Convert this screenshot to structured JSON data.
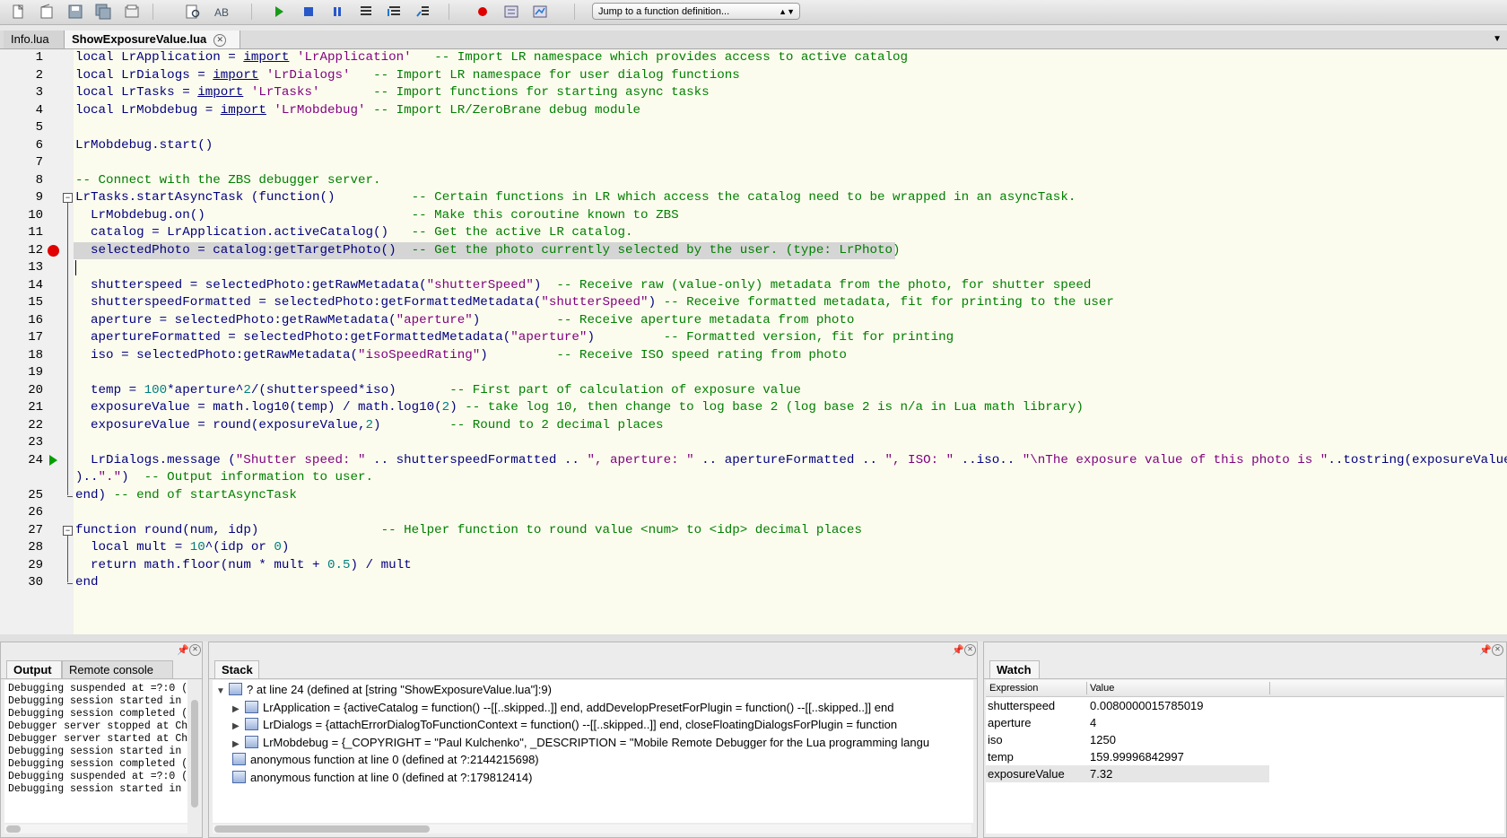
{
  "toolbar": {
    "buttons": [
      "new-file-icon",
      "open-file-icon",
      "save-icon",
      "save-all-icon",
      "project-directory-icon",
      "find-icon",
      "replace-icon",
      "run-icon",
      "stop-icon",
      "break-icon",
      "step-into-icon",
      "step-over-icon",
      "step-out-icon",
      "toggle-breakpoint-icon",
      "stack-window-icon",
      "watch-window-icon"
    ],
    "function_jump": "Jump to a function definition..."
  },
  "tabs": [
    {
      "label": "Info.lua",
      "active": false
    },
    {
      "label": "ShowExposureValue.lua",
      "active": true
    }
  ],
  "editor": {
    "breakpoint_line": 12,
    "current_line": 24,
    "lines": [
      {
        "n": "1",
        "text": "local LrApplication = import 'LrApplication'   -- Import LR namespace which provides access to active catalog"
      },
      {
        "n": "2",
        "text": "local LrDialogs = import 'LrDialogs'   -- Import LR namespace for user dialog functions"
      },
      {
        "n": "3",
        "text": "local LrTasks = import 'LrTasks'       -- Import functions for starting async tasks"
      },
      {
        "n": "4",
        "text": "local LrMobdebug = import 'LrMobdebug' -- Import LR/ZeroBrane debug module"
      },
      {
        "n": "5",
        "text": ""
      },
      {
        "n": "6",
        "text": "LrMobdebug.start()"
      },
      {
        "n": "7",
        "text": ""
      },
      {
        "n": "8",
        "text": "-- Connect with the ZBS debugger server."
      },
      {
        "n": "9",
        "text": "LrTasks.startAsyncTask (function()          -- Certain functions in LR which access the catalog need to be wrapped in an asyncTask."
      },
      {
        "n": "10",
        "text": "  LrMobdebug.on()                           -- Make this coroutine known to ZBS"
      },
      {
        "n": "11",
        "text": "  catalog = LrApplication.activeCatalog()   -- Get the active LR catalog."
      },
      {
        "n": "12",
        "text": "  selectedPhoto = catalog:getTargetPhoto()  -- Get the photo currently selected by the user. (type: LrPhoto)"
      },
      {
        "n": "13",
        "text": ""
      },
      {
        "n": "14",
        "text": "  shutterspeed = selectedPhoto:getRawMetadata(\"shutterSpeed\")  -- Receive raw (value-only) metadata from the photo, for shutter speed"
      },
      {
        "n": "15",
        "text": "  shutterspeedFormatted = selectedPhoto:getFormattedMetadata(\"shutterSpeed\") -- Receive formatted metadata, fit for printing to the user"
      },
      {
        "n": "16",
        "text": "  aperture = selectedPhoto:getRawMetadata(\"aperture\")          -- Receive aperture metadata from photo"
      },
      {
        "n": "17",
        "text": "  apertureFormatted = selectedPhoto:getFormattedMetadata(\"aperture\")         -- Formatted version, fit for printing"
      },
      {
        "n": "18",
        "text": "  iso = selectedPhoto:getRawMetadata(\"isoSpeedRating\")         -- Receive ISO speed rating from photo"
      },
      {
        "n": "19",
        "text": ""
      },
      {
        "n": "20",
        "text": "  temp = 100*aperture^2/(shutterspeed*iso)       -- First part of calculation of exposure value"
      },
      {
        "n": "21",
        "text": "  exposureValue = math.log10(temp) / math.log10(2) -- take log 10, then change to log base 2 (log base 2 is n/a in Lua math library)"
      },
      {
        "n": "22",
        "text": "  exposureValue = round(exposureValue,2)         -- Round to 2 decimal places"
      },
      {
        "n": "23",
        "text": ""
      },
      {
        "n": "24",
        "text": "  LrDialogs.message (\"Shutter speed: \" .. shutterspeedFormatted .. \", aperture: \" .. apertureFormatted .. \", ISO: \" ..iso.. \"\\nThe exposure value of this photo is \"..tostring(exposureValue"
      },
      {
        "n": "",
        "text": ")..\".\")  -- Output information to user."
      },
      {
        "n": "25",
        "text": "end) -- end of startAsyncTask"
      },
      {
        "n": "26",
        "text": ""
      },
      {
        "n": "27",
        "text": "function round(num, idp)                -- Helper function to round value <num> to <idp> decimal places"
      },
      {
        "n": "28",
        "text": "  local mult = 10^(idp or 0)"
      },
      {
        "n": "29",
        "text": "  return math.floor(num * mult + 0.5) / mult"
      },
      {
        "n": "30",
        "text": "end"
      }
    ]
  },
  "output_panel": {
    "tabs": [
      "Output",
      "Remote console"
    ],
    "lines": [
      "Debugging suspended at =?:0 (",
      "Debugging session started in",
      "Debugging session completed (",
      "Debugger server stopped at Ch",
      "Debugger server started at Ch",
      "Debugging session started in",
      "Debugging session completed (",
      "Debugging suspended at =?:0 (",
      "Debugging session started in"
    ]
  },
  "stack_panel": {
    "title": "Stack",
    "rows": [
      {
        "text": "? at line 24 (defined at [string \"ShowExposureValue.lua\"]:9)",
        "level": 0,
        "toggle": "open"
      },
      {
        "text": "LrApplication = {activeCatalog = function() --[[..skipped..]] end, addDevelopPresetForPlugin = function() --[[..skipped..]] end",
        "level": 1,
        "toggle": "closed"
      },
      {
        "text": "LrDialogs = {attachErrorDialogToFunctionContext = function() --[[..skipped..]] end, closeFloatingDialogsForPlugin = function",
        "level": 1,
        "toggle": "closed"
      },
      {
        "text": "LrMobdebug = {_COPYRIGHT = \"Paul Kulchenko\", _DESCRIPTION = \"Mobile Remote Debugger for the Lua programming langu",
        "level": 1,
        "toggle": "closed"
      },
      {
        "text": "anonymous function at line 0 (defined at ?:2144215698)",
        "level": 0,
        "toggle": "none"
      },
      {
        "text": "anonymous function at line 0 (defined at ?:179812414)",
        "level": 0,
        "toggle": "none"
      }
    ]
  },
  "watch_panel": {
    "title": "Watch",
    "col_expression": "Expression",
    "col_value": "Value",
    "rows": [
      {
        "expr": "shutterspeed",
        "value": "0.0080000015785019"
      },
      {
        "expr": "aperture",
        "value": "4"
      },
      {
        "expr": "iso",
        "value": "1250"
      },
      {
        "expr": "temp",
        "value": "159.99996842997"
      },
      {
        "expr": "exposureValue",
        "value": "7.32",
        "selected": true
      }
    ]
  }
}
